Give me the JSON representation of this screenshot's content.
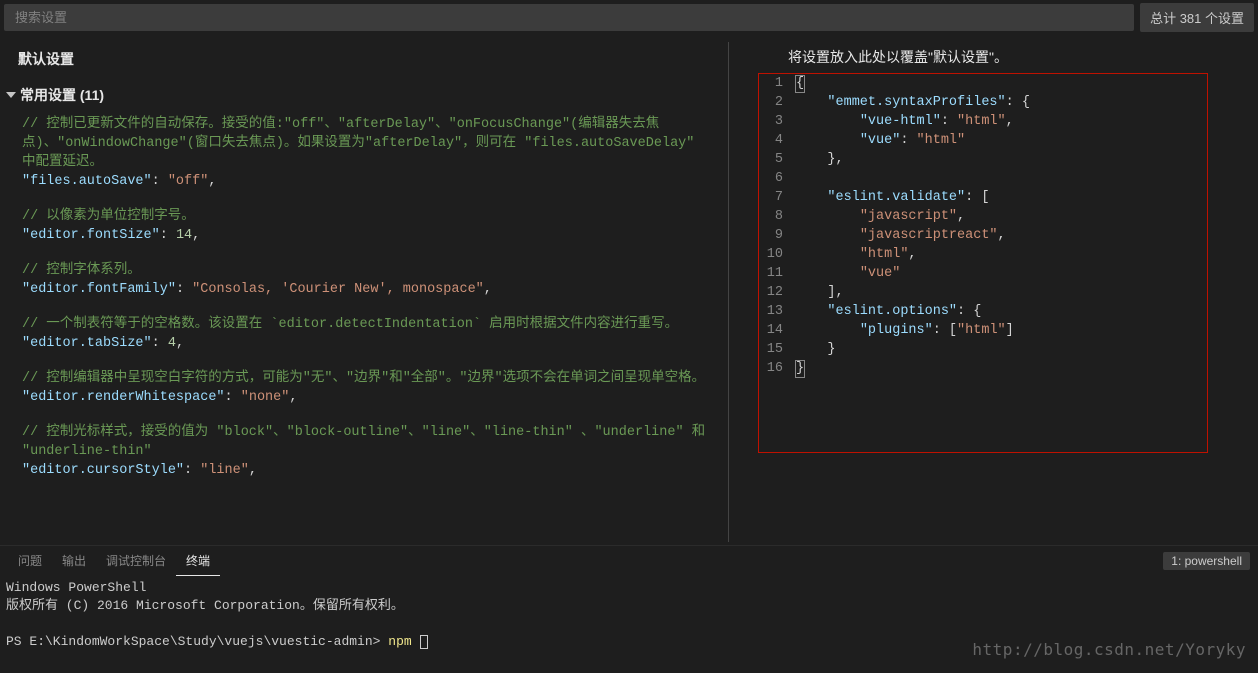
{
  "search": {
    "placeholder": "搜索设置"
  },
  "count_label": "总计 381 个设置",
  "default_title": "默认设置",
  "section_title": "常用设置 (11)",
  "right_header": "将设置放入此处以覆盖\"默认设置\"。",
  "settings": [
    {
      "comment": "// 控制已更新文件的自动保存。接受的值:\"off\"、\"afterDelay\"、\"onFocusChange\"(编辑器失去焦点)、\"onWindowChange\"(窗口失去焦点)。如果设置为\"afterDelay\"，则可在 \"files.autoSaveDelay\" 中配置延迟。",
      "key": "\"files.autoSave\"",
      "value": "\"off\"",
      "type": "string"
    },
    {
      "comment": "// 以像素为单位控制字号。",
      "key": "\"editor.fontSize\"",
      "value": "14",
      "type": "number"
    },
    {
      "comment": "// 控制字体系列。",
      "key": "\"editor.fontFamily\"",
      "value": "\"Consolas, 'Courier New', monospace\"",
      "type": "string"
    },
    {
      "comment": "// 一个制表符等于的空格数。该设置在 `editor.detectIndentation` 启用时根据文件内容进行重写。",
      "key": "\"editor.tabSize\"",
      "value": "4",
      "type": "number"
    },
    {
      "comment": "// 控制编辑器中呈现空白字符的方式，可能为\"无\"、\"边界\"和\"全部\"。\"边界\"选项不会在单词之间呈现单空格。",
      "key": "\"editor.renderWhitespace\"",
      "value": "\"none\"",
      "type": "string"
    },
    {
      "comment": "// 控制光标样式，接受的值为 \"block\"、\"block-outline\"、\"line\"、\"line-thin\" 、\"underline\" 和 \"underline-thin\"",
      "key": "\"editor.cursorStyle\"",
      "value": "\"line\"",
      "type": "string"
    }
  ],
  "user_json": {
    "lines": [
      {
        "n": "1",
        "html": "<span class='hl-brace'>{</span>"
      },
      {
        "n": "2",
        "html": "    <span class='key'>\"emmet.syntaxProfiles\"</span><span class='punct'>: {</span>"
      },
      {
        "n": "3",
        "html": "        <span class='key'>\"vue-html\"</span><span class='punct'>: </span><span class='string'>\"html\"</span><span class='punct'>,</span>"
      },
      {
        "n": "4",
        "html": "        <span class='key'>\"vue\"</span><span class='punct'>: </span><span class='string'>\"html\"</span>"
      },
      {
        "n": "5",
        "html": "    <span class='punct'>},</span>"
      },
      {
        "n": "6",
        "html": ""
      },
      {
        "n": "7",
        "html": "    <span class='key'>\"eslint.validate\"</span><span class='punct'>: [</span>"
      },
      {
        "n": "8",
        "html": "        <span class='string'>\"javascript\"</span><span class='punct'>,</span>"
      },
      {
        "n": "9",
        "html": "        <span class='string'>\"javascriptreact\"</span><span class='punct'>,</span>"
      },
      {
        "n": "10",
        "html": "        <span class='string'>\"html\"</span><span class='punct'>,</span>"
      },
      {
        "n": "11",
        "html": "        <span class='string'>\"vue\"</span>"
      },
      {
        "n": "12",
        "html": "    <span class='punct'>],</span>"
      },
      {
        "n": "13",
        "html": "    <span class='key'>\"eslint.options\"</span><span class='punct'>: {</span>"
      },
      {
        "n": "14",
        "html": "        <span class='key'>\"plugins\"</span><span class='punct'>: [</span><span class='string'>\"html\"</span><span class='punct'>]</span>"
      },
      {
        "n": "15",
        "html": "    <span class='punct'>}</span>"
      },
      {
        "n": "16",
        "html": "<span class='hl-brace'>}</span>"
      }
    ]
  },
  "panel": {
    "tabs": {
      "problems": "问题",
      "output": "输出",
      "debug": "调试控制台",
      "terminal": "终端"
    },
    "selector": "1: powershell"
  },
  "terminal": {
    "line1": "Windows PowerShell",
    "line2": "版权所有 (C) 2016 Microsoft Corporation。保留所有权利。",
    "prompt": "PS E:\\KindomWorkSpace\\Study\\vuejs\\vuestic-admin>",
    "cmd": "npm"
  },
  "watermark": "http://blog.csdn.net/Yoryky"
}
